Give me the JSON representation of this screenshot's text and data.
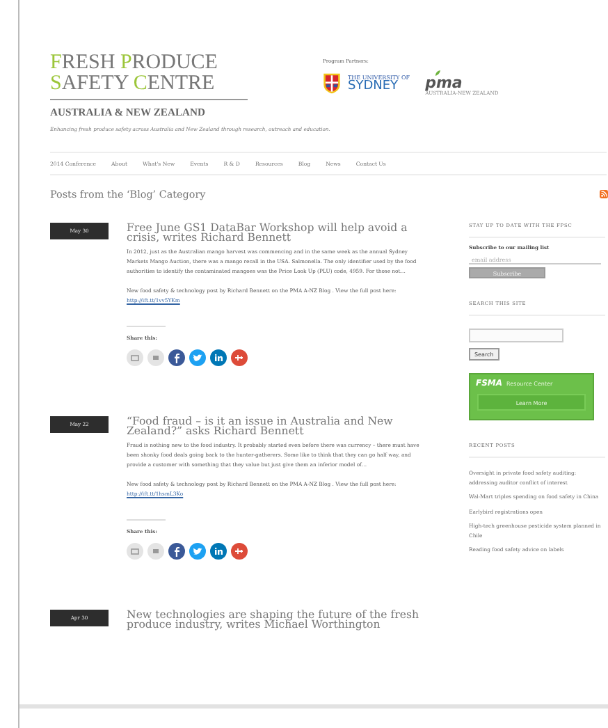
{
  "logo": {
    "lines": [
      "FRESH PRODUCE",
      "SAFETY CENTRE"
    ],
    "region": "AUSTRALIA & NEW ZEALAND"
  },
  "partners": {
    "label": "Program Partners:",
    "university": {
      "small": "THE UNIVERSITY OF",
      "name": "SYDNEY"
    },
    "pma": {
      "name": "pma",
      "sub": "AUSTRALIA-NEW ZEALAND"
    }
  },
  "tagline": "Enhancing fresh produce safety across Australia and New Zealand through research, outreach and education.",
  "nav": [
    "2014 Conference",
    "About",
    "What's New",
    "Events",
    "R & D",
    "Resources",
    "Blog",
    "News",
    "Contact Us"
  ],
  "heading": "Posts from the ‘Blog’ Category",
  "posts": [
    {
      "date": "May 30",
      "title": "Free June GS1 DataBar Workshop will help avoid a crisis, writes Richard Bennett",
      "excerpt": "In 2012, just as the Australian mango harvest was commencing and in the same week as the annual Sydney Markets Mango Auction, there was a mango recall in the USA. Salmonella. The only identifier used by the food authorities to identify the contaminated mangoes was the Price Look Up (PLU) code, 4959. For those not…",
      "view": "New food safety & technology post by Richard Bennett on the PMA A-NZ Blog . View the full post here:",
      "link": "http://ift.tt/1vv5YKm",
      "share": "Share this:"
    },
    {
      "date": "May 22",
      "title": "“Food fraud – is it an issue in Australia and New Zealand?” asks Richard Bennett",
      "excerpt": "Fraud is nothing new to the food industry. It probably started even before there was currency – there must have been shonky food deals going back to the hunter-gatherers. Some like to think that they can go half way, and provide a customer with something that they value but just give them an inferior model of…",
      "view": "New food safety & technology post by Richard Bennett on the PMA A-NZ Blog . View the full post here:",
      "link": "http://ift.tt/1hsmL3Ko",
      "share": "Share this:"
    },
    {
      "date": "Apr 30",
      "title": "New technologies are shaping the future of the fresh produce industry, writes Michael Worthington"
    }
  ],
  "sidebar": {
    "stay_heading": "STAY UP TO DATE WITH THE FPSC",
    "subscribe_label": "Subscribe to our mailing list",
    "email": {
      "placeholder": "email address"
    },
    "subscribe_button": "Subscribe",
    "search_heading": "SEARCH THIS SITE",
    "search_button": "Search",
    "banner": {
      "brand": "FSMA",
      "title": "Resource Center",
      "button": "Learn More"
    },
    "recent_heading": "RECENT POSTS",
    "recent": [
      "Oversight in private food safety auditing: addressing auditor conflict of interest",
      "Wal-Mart triples spending on food safety in China",
      "Earlybird registrations open",
      "High-tech greenhouse pesticide system planned in Chile",
      "Reading food safety advice on labels"
    ]
  }
}
